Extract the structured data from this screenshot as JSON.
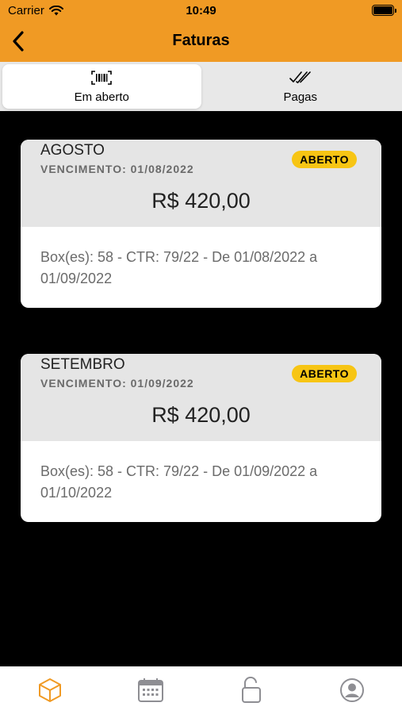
{
  "status": {
    "carrier": "Carrier",
    "time": "10:49"
  },
  "header": {
    "title": "Faturas",
    "back_icon": "chevron-left-icon"
  },
  "tabs": [
    {
      "label": "Em aberto",
      "icon": "barcode-icon",
      "active": true
    },
    {
      "label": "Pagas",
      "icon": "double-check-icon",
      "active": false
    }
  ],
  "invoices": [
    {
      "month": "AGOSTO",
      "due": "VENCIMENTO: 01/08/2022",
      "status": "ABERTO",
      "amount": "R$ 420,00",
      "description": "Box(es): 58 - CTR: 79/22 - De 01/08/2022 a 01/09/2022"
    },
    {
      "month": "SETEMBRO",
      "due": "VENCIMENTO: 01/09/2022",
      "status": "ABERTO",
      "amount": "R$ 420,00",
      "description": "Box(es): 58 - CTR: 79/22 - De 01/09/2022 a 01/10/2022"
    }
  ],
  "bottom_nav": [
    {
      "icon": "box-icon",
      "active": true
    },
    {
      "icon": "calendar-icon",
      "active": false
    },
    {
      "icon": "unlock-icon",
      "active": false
    },
    {
      "icon": "profile-icon",
      "active": false
    }
  ],
  "colors": {
    "header": "#F09A24",
    "badge": "#F7C514",
    "active_nav": "#F09A24",
    "inactive_nav": "#8E8E93"
  }
}
